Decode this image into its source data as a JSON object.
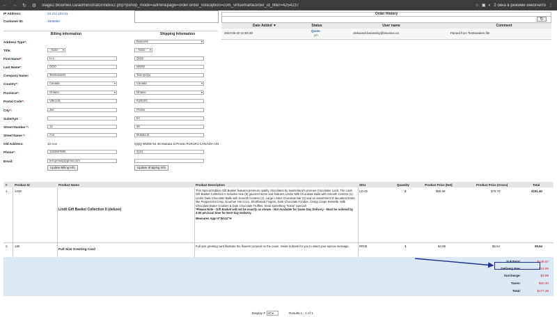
{
  "browser": {
    "url": "stage2.bloomex.ca/administrator/index2.php?pshop_mode=admin&page=order.order_list&option=com_virtuemart&order_id_filter=4254237",
    "incognito_label": "2 окна в режиме инкогнито"
  },
  "customer": {
    "ip_label": "IP Address:",
    "ip_value": "34.212.194.81",
    "customer_id_label": "Customer ID:",
    "customer_id_value": "1905960"
  },
  "address": {
    "billing_header": "Billing Information",
    "shipping_header": "Shipping Information",
    "rows": [
      {
        "label": "Address Type",
        "req": "*",
        "billing": "",
        "shipping": "Business",
        "billing_kind": "none",
        "shipping_kind": "select"
      },
      {
        "label": "Title:",
        "req": "",
        "billing": "- None -",
        "shipping": "- None -",
        "billing_kind": "select_s",
        "shipping_kind": "select_s"
      },
      {
        "label": "First Name",
        "req": "*",
        "billing": "LLL",
        "shipping": "QQQ",
        "billing_kind": "input",
        "shipping_kind": "input"
      },
      {
        "label": "Last Name",
        "req": "*",
        "billing": "OOO",
        "shipping": "WWW",
        "billing_kind": "input",
        "shipping_kind": "input"
      },
      {
        "label": "Company Name:",
        "req": "",
        "billing": "TestSanders",
        "shipping": "Test QcQq",
        "billing_kind": "input",
        "shipping_kind": "input"
      },
      {
        "label": "Country",
        "req": "*",
        "billing": "Canada",
        "shipping": "Canada",
        "billing_kind": "select",
        "shipping_kind": "select"
      },
      {
        "label": "Province",
        "req": "*",
        "billing": "Ontario",
        "shipping": "Ontario",
        "billing_kind": "select",
        "shipping_kind": "select"
      },
      {
        "label": "Postal Code",
        "req": "*",
        "billing": "V5K1A6",
        "shipping": "R1R1R1",
        "billing_kind": "input",
        "shipping_kind": "input"
      },
      {
        "label": "City",
        "req": "*",
        "billing": "Jee",
        "shipping": "Prosto",
        "billing_kind": "input",
        "shipping_kind": "input"
      },
      {
        "label": "Suite/Apt:",
        "req": "",
        "billing": "",
        "shipping": "54",
        "billing_kind": "input",
        "shipping_kind": "input"
      },
      {
        "label": "Street Number ",
        "req": "*",
        "billing": "12",
        "shipping": "46",
        "billing_kind": "input",
        "shipping_kind": "input"
      },
      {
        "label": "Street Name ",
        "req": "*",
        "billing": "Ace",
        "shipping": "Mukata st",
        "billing_kind": "input",
        "shipping_kind": "input"
      },
      {
        "label": "Old Address:",
        "req": "",
        "billing": "12 Ace",
        "shipping": "QQQ WWW 54 46 Mukata st Prosto R1R1R1 CANADA-ON",
        "billing_kind": "text",
        "shipping_kind": "text"
      },
      {
        "label": "Phone",
        "req": "*",
        "billing": "1234567890",
        "shipping": "2131",
        "billing_kind": "input",
        "shipping_kind": "input"
      },
      {
        "label": "Email:",
        "req": "",
        "billing": "test.petudy@gmail.com",
        "shipping": "",
        "billing_kind": "input",
        "shipping_kind": "input"
      }
    ],
    "update_billing": "Update Billing Info",
    "update_shipping": "Update Shipping Info",
    "colon": ":"
  },
  "history": {
    "title": "Order History",
    "refresh_icon": "refresh-icon",
    "columns": [
      "Date Added ▼",
      "Status",
      "User name",
      "Comment"
    ],
    "rows": [
      {
        "date": "2024-06-20 10:51:29",
        "status": "Quote",
        "status_sub": "y/n",
        "user": "oleksandr.baranskiy@bloomex.ca",
        "comment": "Parsed from TestSanders file"
      }
    ]
  },
  "items": {
    "columns": [
      "#",
      "Product Id",
      "Product Name",
      "Product Description",
      "SKU",
      "Quantity",
      "Product Price (Net)",
      "Product Price (Gross)",
      "Total"
    ],
    "rows": [
      {
        "num": "1.",
        "id": "2439",
        "name": "Lindt Gift Basket Collection II (deluxe)",
        "desc": "This Special Edition Gift Basket features premium quality chocolates by Switzerland's premier chocolatier Lindt. The Lindt Gift Basket Collection II includes nine (9) gourmet items and features Lindor Milk Chocolate Balls with Smooth Centres (1), Lindor Dark Chocolate Balls with Smooth Centres (2), Large Lindor Chocolate Bar (2) and an assortment of decadent treats like Peppermint Crisp, Gourmet Hot Coco, Shortbread Fingers, Dark Chocolate Fondue, Crispy Crepe Dentelle, Milk Chocolate Butter Cookies & Dark Chocolate Truffles. Send something \"Extra\" Special!",
        "note": "*Please Note - Gift Basket will not be exactly as shown - Not Available for Same Day Delivery - Must be ordered by 4:00 pm local time for Next Day Delivery.",
        "measure": "Measures Appr 8\"Wx12\"H",
        "sku": "LD-02",
        "qty": "2",
        "net": "$66.99",
        "gross": "$75.70",
        "total": "$151.40"
      },
      {
        "num": "2.",
        "id": "180",
        "name": "Full Size Greeting Card",
        "desc": "Full size greeting card illustrate the flowers pictured on the cover. Inside is blank for you to insert your special message.",
        "note": "",
        "measure": "",
        "sku": "RR05",
        "qty": "1",
        "net": "$4.99",
        "gross": "$5.64",
        "total": "$5.64"
      }
    ]
  },
  "totals": [
    {
      "label": "SubTotal:",
      "value": "$138.67"
    },
    {
      "label": "Delivery Fee:",
      "value": "$19.99"
    },
    {
      "label": "Surcharge:",
      "value": "$2.99"
    },
    {
      "label": "Taxes:",
      "value": "$20.40"
    },
    {
      "label": "Total:",
      "value": "$177.35"
    }
  ],
  "footer": {
    "display_label": "Display #",
    "display_value": "20",
    "results": "Results 1 - 1 of 1"
  },
  "colors": {
    "accent_red": "#cc2222",
    "highlight_arrow": "#1a2f8f",
    "totals_bg": "#dce8f4"
  }
}
